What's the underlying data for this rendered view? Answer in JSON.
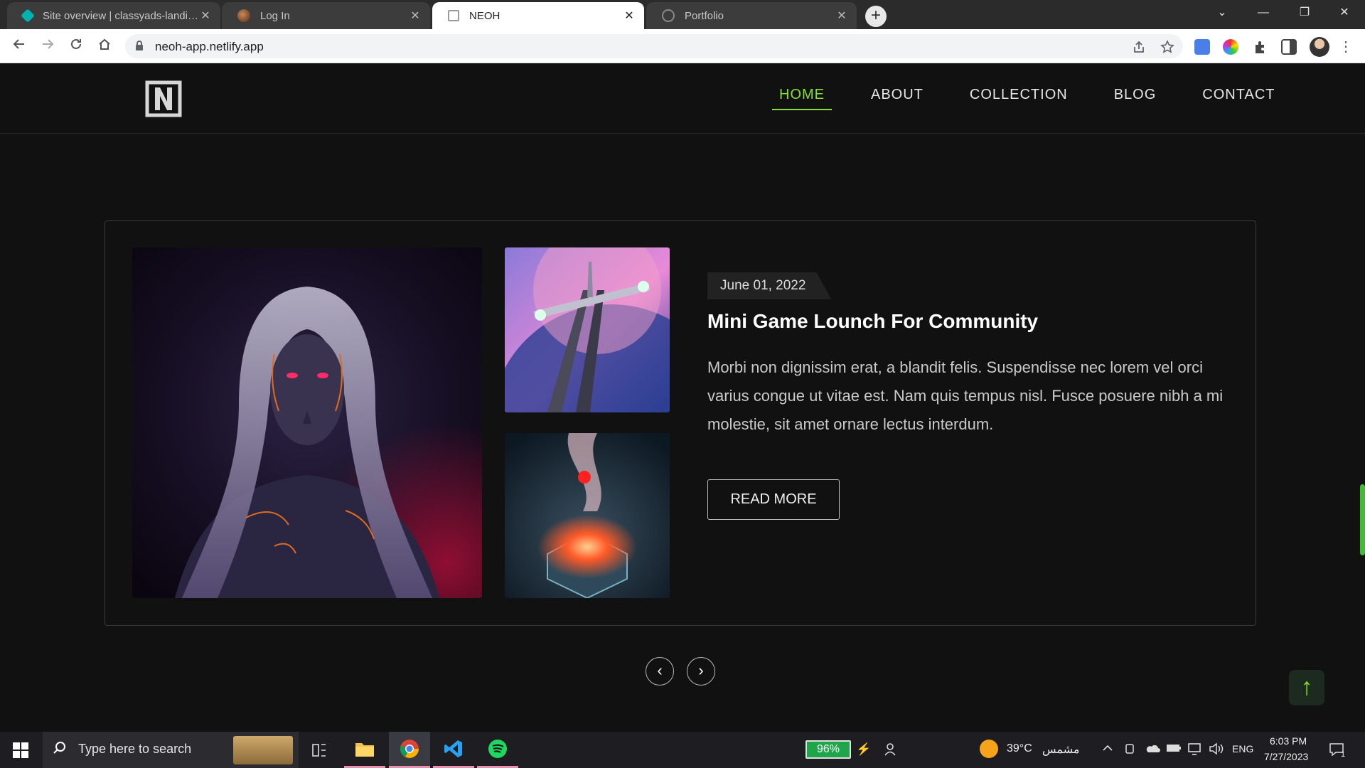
{
  "browser": {
    "tabs": [
      {
        "title": "Site overview | classyads-landing",
        "state": "inactive",
        "favicon_color": "#00b3b0"
      },
      {
        "title": "Log In",
        "state": "inactive",
        "favicon_color": "#8a4b2c"
      },
      {
        "title": "NEOH",
        "state": "active",
        "favicon_color": "#9a9a9a"
      },
      {
        "title": "Portfolio",
        "state": "inactive",
        "favicon_color": "#8a8a8a"
      }
    ],
    "tab_close_glyph": "✕",
    "new_tab_glyph": "+",
    "window_controls": {
      "tab_search": "⌄",
      "minimize": "—",
      "restore": "❐",
      "close": "✕"
    },
    "url": "neoh-app.netlify.app",
    "nav_icons": [
      "back-icon",
      "forward-icon",
      "reload-icon",
      "home-icon"
    ]
  },
  "site": {
    "logo_letter": "N",
    "nav": [
      {
        "label": "HOME",
        "active": true
      },
      {
        "label": "ABOUT",
        "active": false
      },
      {
        "label": "COLLECTION",
        "active": false
      },
      {
        "label": "BLOG",
        "active": false
      },
      {
        "label": "CONTACT",
        "active": false
      }
    ],
    "accent_color": "#84e02c",
    "post": {
      "date": "June 01, 2022",
      "title": "Mini Game Lounch For Community",
      "body": "Morbi non dignissim erat, a blandit felis. Suspendisse nec lorem vel orci varius congue ut vitae est. Nam quis tempus nisl. Fusce posuere nibh a mi molestie, sit amet ornare lectus interdum.",
      "read_more": "READ MORE"
    },
    "slider": {
      "prev": "‹",
      "next": "›"
    },
    "scroll_top_glyph": "↑"
  },
  "taskbar": {
    "search_placeholder": "Type here to search",
    "apps": [
      "task-view-icon",
      "file-explorer-icon",
      "chrome-icon",
      "vscode-icon",
      "spotify-icon"
    ],
    "battery": "96%",
    "weather_temp": "39°C",
    "weather_text": "مشمس",
    "language": "ENG",
    "time": "6:03 PM",
    "date": "7/27/2023",
    "notification_count": "1"
  }
}
